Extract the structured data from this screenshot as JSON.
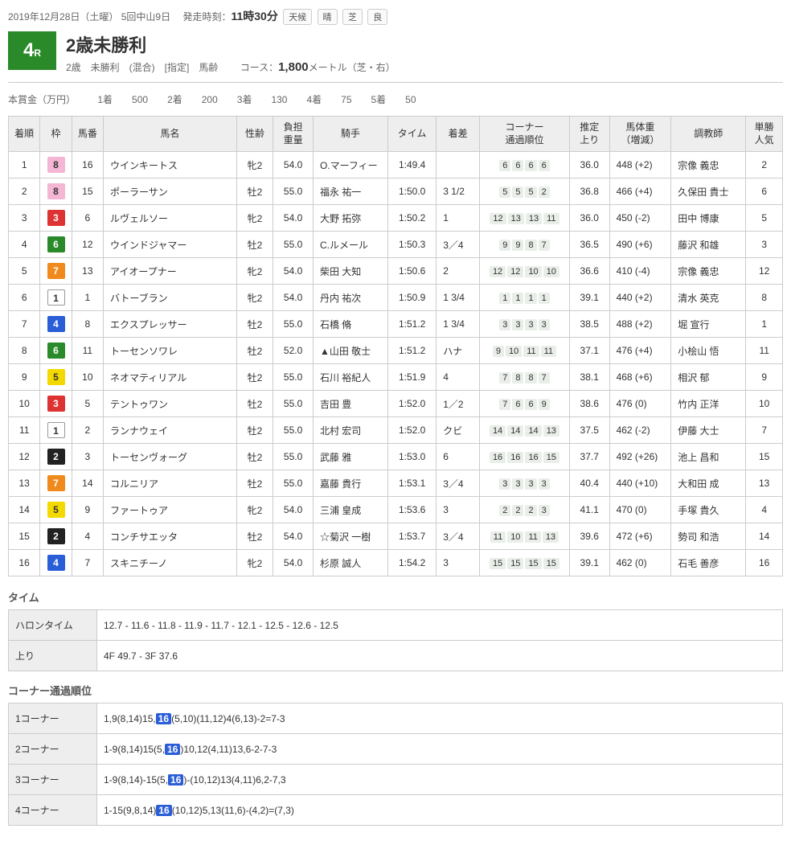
{
  "date_line": {
    "date": "2019年12月28日（土曜）",
    "meet": "5回中山9日",
    "start_label": "発走時刻：",
    "start_time": "11時30分",
    "weather_label": "天候",
    "weather": "晴",
    "track_label": "芝",
    "track_cond": "良"
  },
  "race": {
    "num": "4",
    "num_suffix": "R",
    "title": "2歳未勝利",
    "sub": "2歳　未勝利　(混合)　[指定]　馬齢",
    "course_label": "コース：",
    "distance": "1,800",
    "course_suffix": "メートル（芝・右）"
  },
  "prize": {
    "label": "本賞金（万円）",
    "items": [
      {
        "k": "1着",
        "v": "500"
      },
      {
        "k": "2着",
        "v": "200"
      },
      {
        "k": "3着",
        "v": "130"
      },
      {
        "k": "4着",
        "v": "75"
      },
      {
        "k": "5着",
        "v": "50"
      }
    ]
  },
  "headers": [
    "着順",
    "枠",
    "馬番",
    "馬名",
    "性齢",
    "負担重量",
    "騎手",
    "タイム",
    "着差",
    "コーナー通過順位",
    "推定上り",
    "馬体重（増減）",
    "調教師",
    "単勝人気"
  ],
  "widths": [
    "38",
    "38",
    "38",
    "160",
    "44",
    "48",
    "90",
    "58",
    "52",
    "108",
    "48",
    "74",
    "90",
    "44"
  ],
  "rows": [
    {
      "pos": "1",
      "waku": "8",
      "num": "16",
      "horse": "ウインキートス",
      "sa": "牝2",
      "wt": "54.0",
      "jockey": "O.マーフィー",
      "time": "1:49.4",
      "margin": "",
      "corners": [
        "6",
        "6",
        "6",
        "6"
      ],
      "agari": "36.0",
      "bw": "448 (+2)",
      "trainer": "宗像 義忠",
      "pop": "2"
    },
    {
      "pos": "2",
      "waku": "8",
      "num": "15",
      "horse": "ポーラーサン",
      "sa": "牡2",
      "wt": "55.0",
      "jockey": "福永 祐一",
      "time": "1:50.0",
      "margin": "3 1/2",
      "corners": [
        "5",
        "5",
        "5",
        "2"
      ],
      "agari": "36.8",
      "bw": "466 (+4)",
      "trainer": "久保田 貴士",
      "pop": "6"
    },
    {
      "pos": "3",
      "waku": "3",
      "num": "6",
      "horse": "ルヴェルソー",
      "sa": "牝2",
      "wt": "54.0",
      "jockey": "大野 拓弥",
      "time": "1:50.2",
      "margin": "1",
      "corners": [
        "12",
        "13",
        "13",
        "11"
      ],
      "agari": "36.0",
      "bw": "450 (-2)",
      "trainer": "田中 博康",
      "pop": "5"
    },
    {
      "pos": "4",
      "waku": "6",
      "num": "12",
      "horse": "ウインドジャマー",
      "sa": "牡2",
      "wt": "55.0",
      "jockey": "C.ルメール",
      "time": "1:50.3",
      "margin": "3／4",
      "corners": [
        "9",
        "9",
        "8",
        "7"
      ],
      "agari": "36.5",
      "bw": "490 (+6)",
      "trainer": "藤沢 和雄",
      "pop": "3"
    },
    {
      "pos": "5",
      "waku": "7",
      "num": "13",
      "horse": "アイオープナー",
      "sa": "牝2",
      "wt": "54.0",
      "jockey": "柴田 大知",
      "time": "1:50.6",
      "margin": "2",
      "corners": [
        "12",
        "12",
        "10",
        "10"
      ],
      "agari": "36.6",
      "bw": "410 (-4)",
      "trainer": "宗像 義忠",
      "pop": "12"
    },
    {
      "pos": "6",
      "waku": "1",
      "num": "1",
      "horse": "バトーブラン",
      "sa": "牝2",
      "wt": "54.0",
      "jockey": "丹内 祐次",
      "time": "1:50.9",
      "margin": "1 3/4",
      "corners": [
        "1",
        "1",
        "1",
        "1"
      ],
      "agari": "39.1",
      "bw": "440 (+2)",
      "trainer": "清水 英克",
      "pop": "8"
    },
    {
      "pos": "7",
      "waku": "4",
      "num": "8",
      "horse": "エクスプレッサー",
      "sa": "牡2",
      "wt": "55.0",
      "jockey": "石橋 脩",
      "time": "1:51.2",
      "margin": "1 3/4",
      "corners": [
        "3",
        "3",
        "3",
        "3"
      ],
      "agari": "38.5",
      "bw": "488 (+2)",
      "trainer": "堀 宣行",
      "pop": "1"
    },
    {
      "pos": "8",
      "waku": "6",
      "num": "11",
      "horse": "トーセンソワレ",
      "sa": "牡2",
      "wt": "52.0",
      "jockey": "▲山田 敬士",
      "time": "1:51.2",
      "margin": "ハナ",
      "corners": [
        "9",
        "10",
        "11",
        "11"
      ],
      "agari": "37.1",
      "bw": "476 (+4)",
      "trainer": "小桧山 悟",
      "pop": "11"
    },
    {
      "pos": "9",
      "waku": "5",
      "num": "10",
      "horse": "ネオマティリアル",
      "sa": "牡2",
      "wt": "55.0",
      "jockey": "石川 裕紀人",
      "time": "1:51.9",
      "margin": "4",
      "corners": [
        "7",
        "8",
        "8",
        "7"
      ],
      "agari": "38.1",
      "bw": "468 (+6)",
      "trainer": "相沢 郁",
      "pop": "9"
    },
    {
      "pos": "10",
      "waku": "3",
      "num": "5",
      "horse": "テントゥワン",
      "sa": "牡2",
      "wt": "55.0",
      "jockey": "吉田 豊",
      "time": "1:52.0",
      "margin": "1／2",
      "corners": [
        "7",
        "6",
        "6",
        "9"
      ],
      "agari": "38.6",
      "bw": "476 (0)",
      "trainer": "竹内 正洋",
      "pop": "10"
    },
    {
      "pos": "11",
      "waku": "1",
      "num": "2",
      "horse": "ランナウェイ",
      "sa": "牡2",
      "wt": "55.0",
      "jockey": "北村 宏司",
      "time": "1:52.0",
      "margin": "クビ",
      "corners": [
        "14",
        "14",
        "14",
        "13"
      ],
      "agari": "37.5",
      "bw": "462 (-2)",
      "trainer": "伊藤 大士",
      "pop": "7"
    },
    {
      "pos": "12",
      "waku": "2",
      "num": "3",
      "horse": "トーセンヴォーグ",
      "sa": "牡2",
      "wt": "55.0",
      "jockey": "武藤 雅",
      "time": "1:53.0",
      "margin": "6",
      "corners": [
        "16",
        "16",
        "16",
        "15"
      ],
      "agari": "37.7",
      "bw": "492 (+26)",
      "trainer": "池上 昌和",
      "pop": "15"
    },
    {
      "pos": "13",
      "waku": "7",
      "num": "14",
      "horse": "コルニリア",
      "sa": "牡2",
      "wt": "55.0",
      "jockey": "嘉藤 貴行",
      "time": "1:53.1",
      "margin": "3／4",
      "corners": [
        "3",
        "3",
        "3",
        "3"
      ],
      "agari": "40.4",
      "bw": "440 (+10)",
      "trainer": "大和田 成",
      "pop": "13"
    },
    {
      "pos": "14",
      "waku": "5",
      "num": "9",
      "horse": "ファートゥア",
      "sa": "牝2",
      "wt": "54.0",
      "jockey": "三浦 皇成",
      "time": "1:53.6",
      "margin": "3",
      "corners": [
        "2",
        "2",
        "2",
        "3"
      ],
      "agari": "41.1",
      "bw": "470 (0)",
      "trainer": "手塚 貴久",
      "pop": "4"
    },
    {
      "pos": "15",
      "waku": "2",
      "num": "4",
      "horse": "コンチサエッタ",
      "sa": "牡2",
      "wt": "54.0",
      "jockey": "☆菊沢 一樹",
      "time": "1:53.7",
      "margin": "3／4",
      "corners": [
        "11",
        "10",
        "11",
        "13"
      ],
      "agari": "39.6",
      "bw": "472 (+6)",
      "trainer": "勢司 和浩",
      "pop": "14"
    },
    {
      "pos": "16",
      "waku": "4",
      "num": "7",
      "horse": "スキニチーノ",
      "sa": "牝2",
      "wt": "54.0",
      "jockey": "杉原 誠人",
      "time": "1:54.2",
      "margin": "3",
      "corners": [
        "15",
        "15",
        "15",
        "15"
      ],
      "agari": "39.1",
      "bw": "462 (0)",
      "trainer": "石毛 善彦",
      "pop": "16"
    }
  ],
  "time_section": {
    "title": "タイム",
    "rows": [
      {
        "k": "ハロンタイム",
        "v": "12.7 - 11.6 - 11.8 - 11.9 - 11.7 - 12.1 - 12.5 - 12.6 - 12.5"
      },
      {
        "k": "上り",
        "v": "4F 49.7 - 3F 37.6"
      }
    ]
  },
  "corner_section": {
    "title": "コーナー通過順位",
    "rows": [
      {
        "k": "1コーナー",
        "parts": [
          "1,9(8,14)15,",
          {
            "hl": "16"
          },
          "(5,10)(11,12)4(6,13)-2=7-3"
        ]
      },
      {
        "k": "2コーナー",
        "parts": [
          "1-9(8,14)15(5,",
          {
            "hl": "16"
          },
          ")10,12(4,11)13,6-2-7-3"
        ]
      },
      {
        "k": "3コーナー",
        "parts": [
          "1-9(8,14)-15(5,",
          {
            "hl": "16"
          },
          ")-(10,12)13(4,11)6,2-7,3"
        ]
      },
      {
        "k": "4コーナー",
        "parts": [
          "1-15(9,8,14)",
          {
            "hl": "16"
          },
          "(10,12)5,13(11,6)-(4,2)=(7,3)"
        ]
      }
    ]
  }
}
